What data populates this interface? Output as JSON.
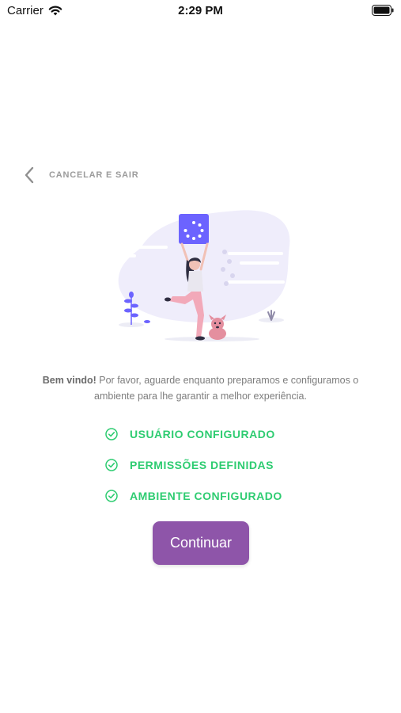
{
  "status_bar": {
    "carrier": "Carrier",
    "time": "2:29 PM"
  },
  "header": {
    "back_label": "CANCELAR E SAIR"
  },
  "welcome": {
    "strong": "Bem vindo!",
    "line1": " Por favor, aguarde enquanto preparamos e configuramos o",
    "line2": "ambiente para lhe garantir a melhor experiência."
  },
  "checklist": [
    {
      "label": "USUÁRIO CONFIGURADO",
      "done": true
    },
    {
      "label": "PERMISSÕES DEFINIDAS",
      "done": true
    },
    {
      "label": "AMBIENTE CONFIGURADO",
      "done": true
    }
  ],
  "actions": {
    "continue_label": "Continuar"
  },
  "colors": {
    "accent": "#8e55a9",
    "success": "#2ecc71",
    "illustration": "#6c63ff"
  }
}
